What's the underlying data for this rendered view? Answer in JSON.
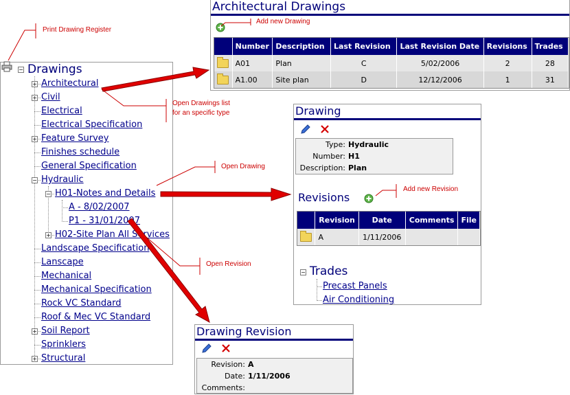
{
  "annotations": {
    "print_register": "Print Drawing Register",
    "add_drawing": "Add new Drawing",
    "open_list_line1": "Open Drawings list",
    "open_list_line2": "for an specific type",
    "open_drawing": "Open Drawing",
    "add_revision": "Add new Revision",
    "open_revision": "Open Revision"
  },
  "tree": {
    "root_label": "Drawings",
    "items": [
      {
        "label": "Architectural"
      },
      {
        "label": "Civil"
      },
      {
        "label": "Electrical"
      },
      {
        "label": "Electrical Specification"
      },
      {
        "label": "Feature Survey"
      },
      {
        "label": "Finishes schedule"
      },
      {
        "label": "General Specification"
      },
      {
        "label": "Hydraulic"
      },
      {
        "label": "H01-Notes and Details"
      },
      {
        "label": "A - 8/02/2007"
      },
      {
        "label": "P1 - 31/01/2007"
      },
      {
        "label": "H02-Site Plan All Services"
      },
      {
        "label": "Landscape Specification"
      },
      {
        "label": "Lanscape"
      },
      {
        "label": "Mechanical"
      },
      {
        "label": "Mechanical Specification"
      },
      {
        "label": "Rock VC Standard"
      },
      {
        "label": "Roof & Mec VC Standard"
      },
      {
        "label": "Soil Report"
      },
      {
        "label": "Sprinklers"
      },
      {
        "label": "Structural"
      }
    ]
  },
  "arch_panel": {
    "title": "Architectural Drawings",
    "columns": [
      "Number",
      "Description",
      "Last Revision",
      "Last Revision Date",
      "Revisions",
      "Trades"
    ],
    "rows": [
      [
        "A01",
        "Plan",
        "C",
        "5/02/2006",
        "2",
        "28"
      ],
      [
        "A1.00",
        "Site plan",
        "D",
        "12/12/2006",
        "1",
        "31"
      ]
    ]
  },
  "drawing_panel": {
    "title": "Drawing",
    "fields": [
      {
        "label": "Type:",
        "value": "Hydraulic"
      },
      {
        "label": "Number:",
        "value": "H1"
      },
      {
        "label": "Description:",
        "value": "Plan"
      }
    ],
    "revisions_title": "Revisions",
    "rev_columns": [
      "Revision",
      "Date",
      "Comments",
      "File"
    ],
    "rev_rows": [
      [
        "A",
        "1/11/2006",
        "",
        ""
      ]
    ],
    "trades_title": "Trades",
    "trades": [
      "Precast Panels",
      "Air Conditioning"
    ]
  },
  "revision_panel": {
    "title": "Drawing Revision",
    "fields": [
      {
        "label": "Revision:",
        "value": "A"
      },
      {
        "label": "Date:",
        "value": "1/11/2006"
      },
      {
        "label": "Comments:",
        "value": ""
      }
    ]
  },
  "colors": {
    "accent": "#00007a",
    "link": "#00008b",
    "annotation": "#cc0000",
    "arrow": "#e00000"
  }
}
